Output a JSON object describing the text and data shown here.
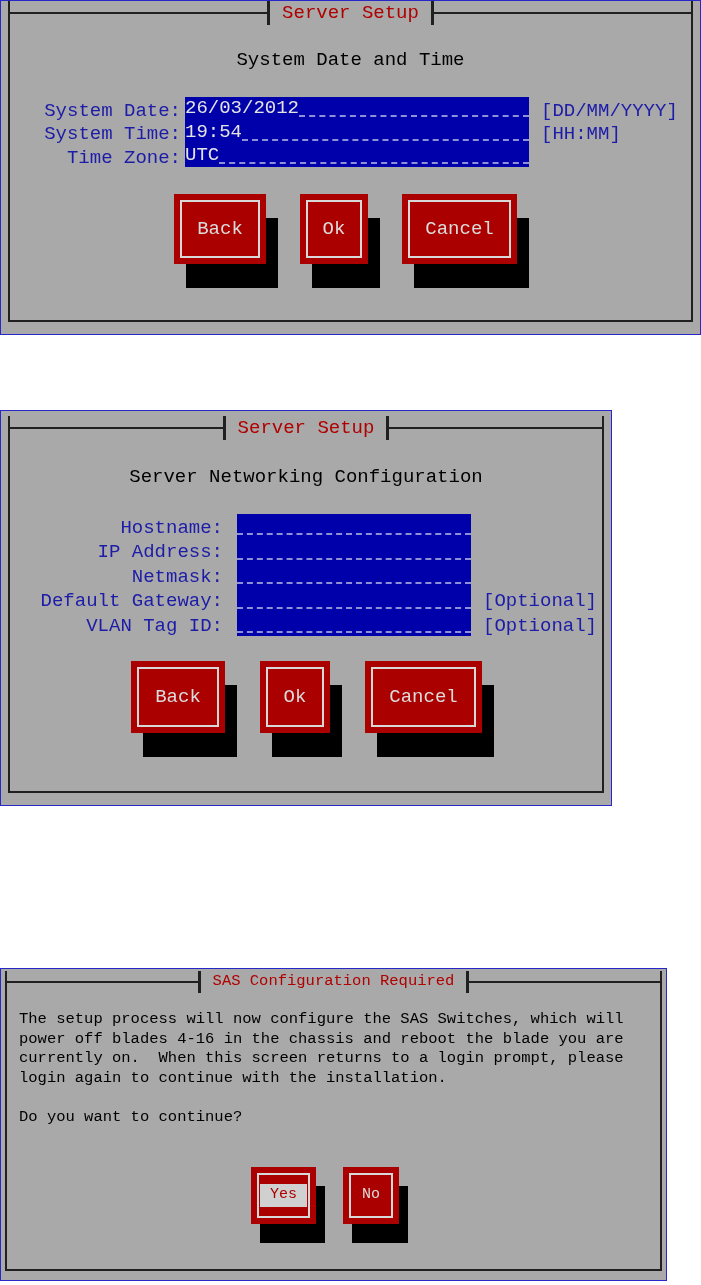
{
  "screens": [
    {
      "kind": "form",
      "title": "Server Setup",
      "heading": "System Date and Time",
      "fields": [
        {
          "label": "System Date:",
          "value": "26/03/2012",
          "hint": "[DD/MM/YYYY]"
        },
        {
          "label": "System Time:",
          "value": "19:54",
          "hint": "[HH:MM]"
        },
        {
          "label": "Time Zone:",
          "value": "UTC"
        }
      ],
      "buttons": [
        {
          "label": "Back",
          "selected": false
        },
        {
          "label": "Ok",
          "selected": false
        },
        {
          "label": "Cancel",
          "selected": false
        }
      ]
    },
    {
      "kind": "form",
      "title": "Server Setup",
      "heading": "Server Networking Configuration",
      "fields": [
        {
          "label": "Hostname:"
        },
        {
          "label": "IP Address:"
        },
        {
          "label": "Netmask:"
        },
        {
          "label": "Default Gateway:",
          "hint": "[Optional]"
        },
        {
          "label": "VLAN Tag ID:",
          "hint": "[Optional]"
        }
      ],
      "buttons": [
        {
          "label": "Back",
          "selected": false
        },
        {
          "label": "Ok",
          "selected": false
        },
        {
          "label": "Cancel",
          "selected": false
        }
      ]
    },
    {
      "kind": "message",
      "title": "SAS Configuration Required",
      "paragraphs": [
        "The setup process will now configure the SAS Switches, which will\npower off blades 4-16 in the chassis and reboot the blade you are\ncurrently on.  When this screen returns to a login prompt, please\nlogin again to continue with the installation.",
        "Do you want to continue?"
      ],
      "buttons": [
        {
          "label": "Yes",
          "selected": true
        },
        {
          "label": "No",
          "selected": false
        }
      ]
    }
  ]
}
